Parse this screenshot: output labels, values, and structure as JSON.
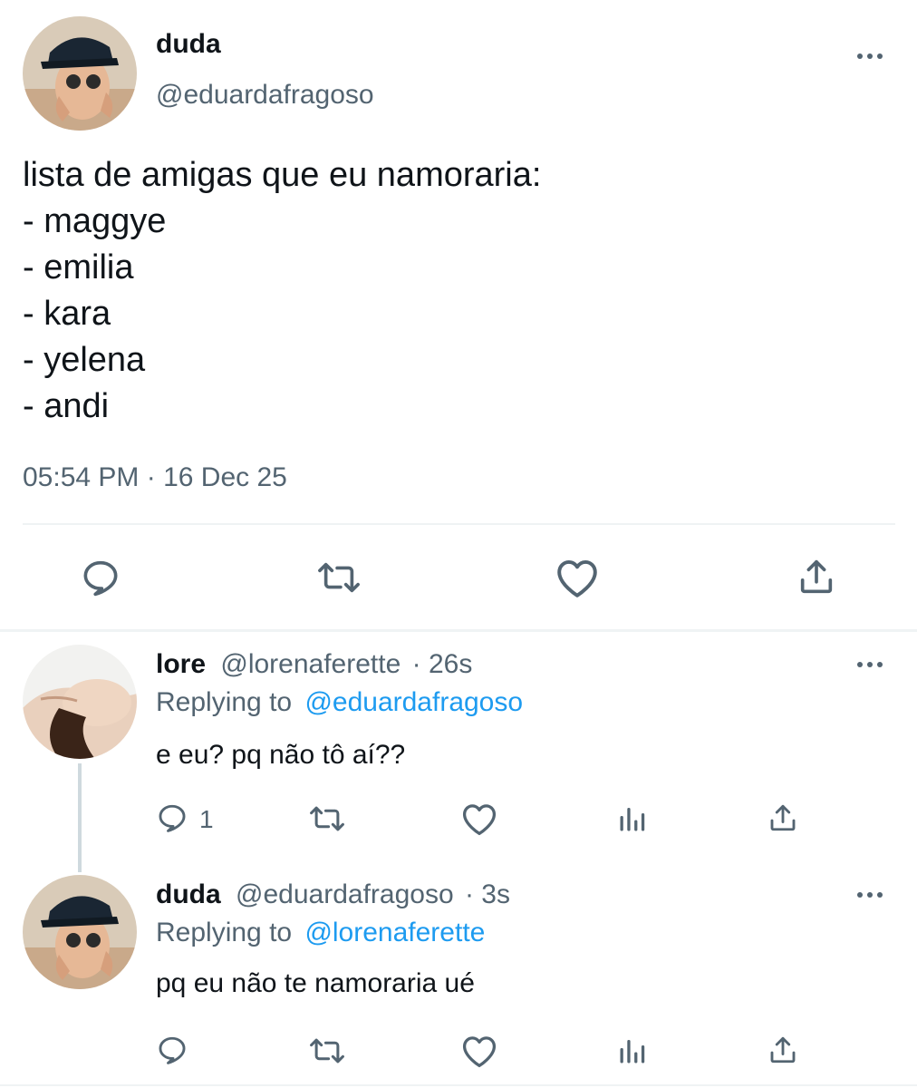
{
  "main_tweet": {
    "display_name": "duda",
    "handle": "@eduardafragoso",
    "text_lines": [
      "lista de amigas que eu namoraria:",
      "- maggye",
      "- emilia",
      "- kara",
      "- yelena",
      "- andi"
    ],
    "timestamp": "05:54 PM · 16 Dec 25"
  },
  "replies": [
    {
      "display_name": "lore",
      "handle": "@lorenaferette",
      "time": "· 26s",
      "replying_prefix": "Replying to",
      "replying_to": "@eduardafragoso",
      "text": "e eu? pq não tô aí??",
      "reply_count": "1"
    },
    {
      "display_name": "duda",
      "handle": "@eduardafragoso",
      "time": "· 3s",
      "replying_prefix": "Replying to",
      "replying_to": "@lorenaferette",
      "text": "pq eu não te namoraria ué",
      "reply_count": ""
    }
  ],
  "icons": {
    "more": "more-horizontal-icon",
    "reply": "reply-bubble-icon",
    "retweet": "retweet-icon",
    "like": "heart-icon",
    "share": "share-icon",
    "analytics": "analytics-bar-icon"
  },
  "colors": {
    "text": "#0f1419",
    "muted": "#536471",
    "link": "#1d9bf0",
    "divider": "#eff3f4"
  }
}
